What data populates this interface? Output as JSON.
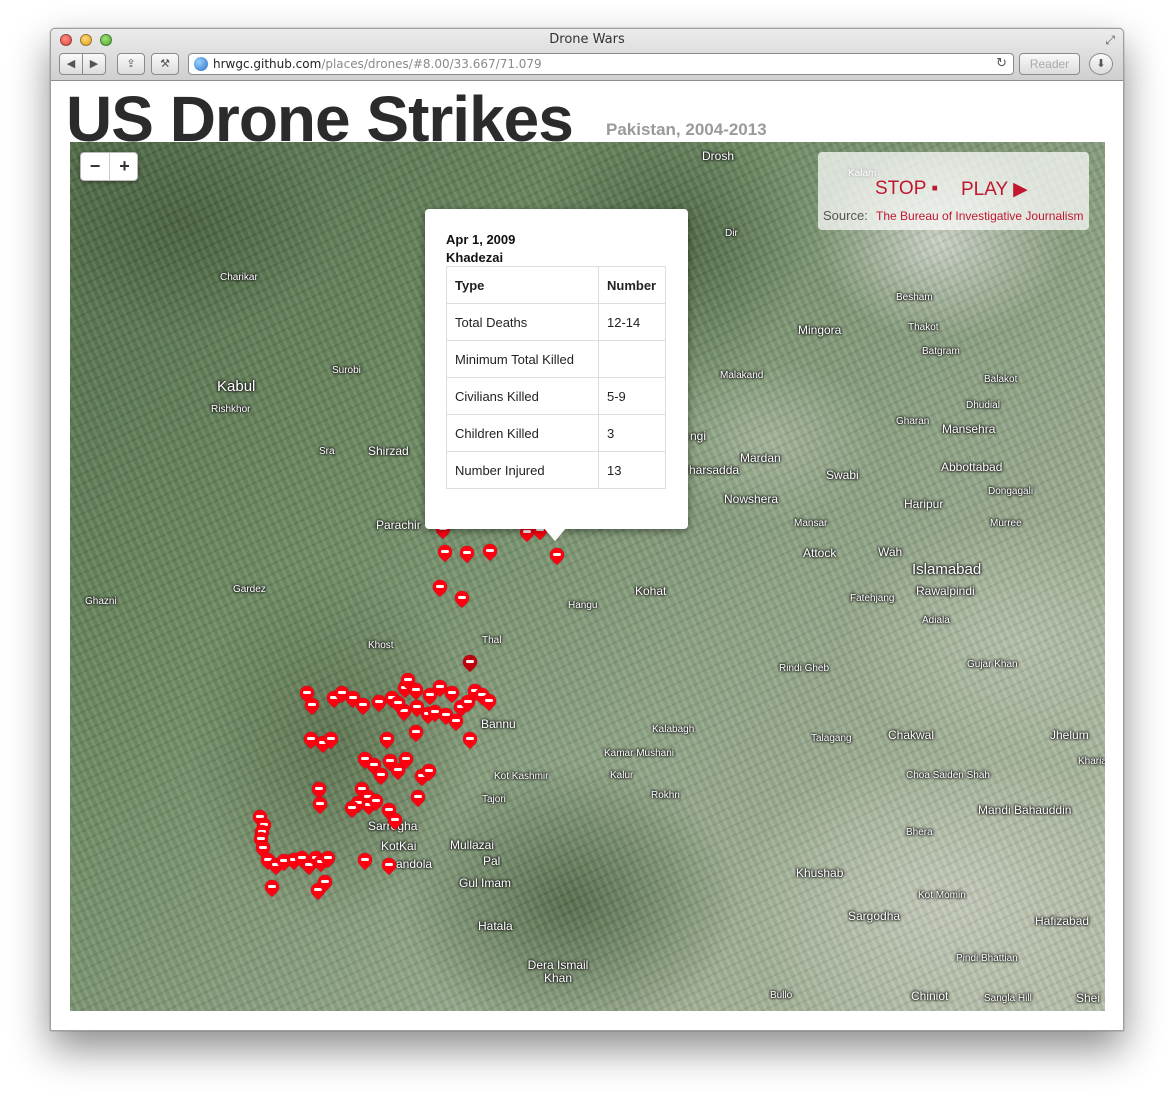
{
  "browser": {
    "window_title": "Drone Wars",
    "url_host": "hrwgc.github.com",
    "url_path": "/places/drones/#8.00/33.667/71.079",
    "reader_label": "Reader"
  },
  "page": {
    "title": "US Drone Strikes",
    "subtitle": "Pakistan, 2004-2013"
  },
  "map": {
    "zoom_out_label": "−",
    "zoom_in_label": "+",
    "controls": {
      "stop_label": "STOP ▪",
      "play_label": "PLAY ▶",
      "source_label": "Source:",
      "source_link": "The Bureau of Investigative Journalism"
    },
    "popup": {
      "date": "Apr 1, 2009",
      "place": "Khadezai",
      "header": [
        "Type",
        "Number"
      ],
      "rows": [
        [
          "Total Deaths",
          "12-14"
        ],
        [
          "Minimum Total Killed",
          ""
        ],
        [
          "Civilians Killed",
          "5-9"
        ],
        [
          "Children Killed",
          "3"
        ],
        [
          "Number Injured",
          "13"
        ]
      ]
    },
    "places": [
      "Drosh",
      "Kalam",
      "Dir",
      "Charikar",
      "Besham",
      "Mingora",
      "Thakot",
      "Batgram",
      "Surobi",
      "Malakand",
      "Balakot",
      "Kabul",
      "Rishkhor",
      "Dhudial",
      "Gharan",
      "Mansehra",
      "Sra",
      "Shirzad",
      "Mardan",
      "Abbottabad",
      "harsadda",
      "Swabi",
      "ngi",
      "Dongagali",
      "Nowshera",
      "Haripur",
      "Parachir",
      "Mansar",
      "Murree",
      "Attock",
      "Wah",
      "Islamabad",
      "Rawalpindi",
      "Gardez",
      "Fatehjang",
      "Ghazni",
      "Kohat",
      "Hangu",
      "Adiala",
      "Thal",
      "Khost",
      "Rindi Gheb",
      "Gujar Khan",
      "Bannu",
      "Kalabagh",
      "Chakwal",
      "Jhelum",
      "Talagang",
      "Kamar Mushani",
      "Kharia",
      "Kot Kashmir",
      "Kalur",
      "Choa Saiden Shah",
      "Tajori",
      "Rokhri",
      "Mandi Bahauddin",
      "Sarrogha",
      "Bhera",
      "Mullazai",
      "KotKai",
      "Pal",
      "andola",
      "Khushab",
      "Gul Imam",
      "Kot Momin",
      "Sargodha",
      "Hafizabad",
      "Hatala",
      "Dera Ismail Khan",
      "Pindi Bhattian",
      "Bullo",
      "Chiniot",
      "Sangla Hill",
      "Shei"
    ]
  }
}
